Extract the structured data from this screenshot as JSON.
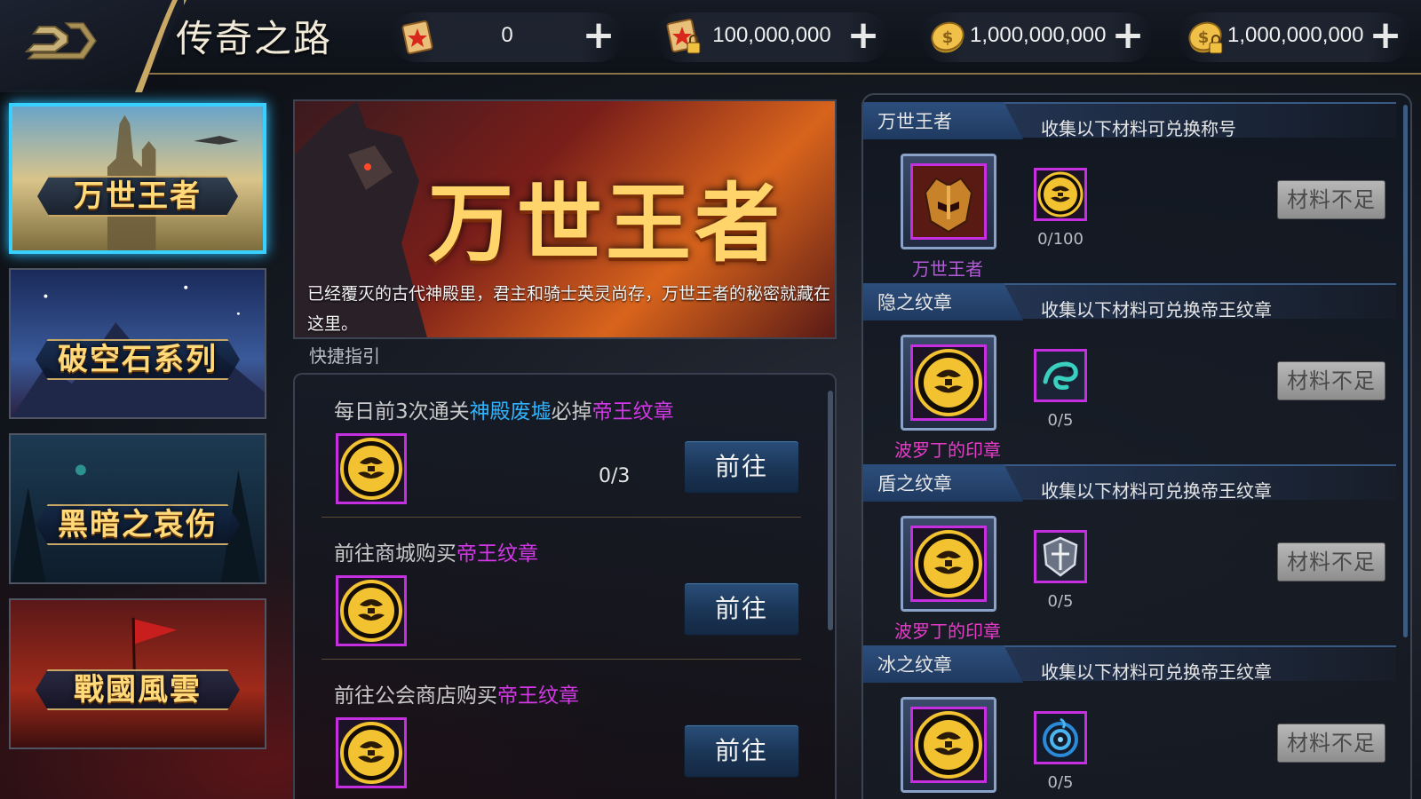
{
  "header": {
    "title": "传奇之路",
    "back_icon": "back-arrow-icon",
    "currencies": [
      {
        "icon": "red-scroll-icon",
        "value": "0"
      },
      {
        "icon": "locked-red-scroll-icon",
        "value": "100,000,000"
      },
      {
        "icon": "gold-coin-icon",
        "value": "1,000,000,000"
      },
      {
        "icon": "locked-gold-coin-icon",
        "value": "1,000,000,000"
      }
    ],
    "plus_label": "+"
  },
  "nav": {
    "items": [
      {
        "label": "万世王者",
        "active": true
      },
      {
        "label": "破空石系列",
        "active": false
      },
      {
        "label": "黑暗之哀伤",
        "active": false
      },
      {
        "label": "戰國風雲",
        "active": false
      }
    ]
  },
  "banner": {
    "title": "万世王者",
    "description": "已经覆灭的古代神殿里，君主和骑士英灵尚存，万世王者的秘密就藏在这里。"
  },
  "guide": {
    "label": "快捷指引",
    "tasks": [
      {
        "prefix": "每日前3次通关",
        "place": "神殿废墟",
        "middle": "必掉",
        "item": "帝王纹章",
        "progress": "0/3",
        "button": "前往"
      },
      {
        "prefix": "前往商城购买",
        "place": "",
        "middle": "",
        "item": "帝王纹章",
        "progress": "",
        "button": "前往"
      },
      {
        "prefix": "前往公会商店购买",
        "place": "",
        "middle": "",
        "item": "帝王纹章",
        "progress": "",
        "button": "前往"
      }
    ]
  },
  "exchange": {
    "items": [
      {
        "title": "万世王者",
        "desc": "收集以下材料可兑换称号",
        "reward_name": "万世王者",
        "reward_color": "#b35bd8",
        "reward_icon": "warrior-helmet-icon",
        "material_icon": "emperor-crest-icon",
        "count": "0/100",
        "button": "材料不足"
      },
      {
        "title": "隐之纹章",
        "desc": "收集以下材料可兑换帝王纹章",
        "reward_name": "波罗丁的印章",
        "reward_color": "#e63cc8",
        "reward_icon": "emperor-crest-icon",
        "material_icon": "serpent-emblem-icon",
        "count": "0/5",
        "button": "材料不足"
      },
      {
        "title": "盾之纹章",
        "desc": "收集以下材料可兑换帝王纹章",
        "reward_name": "波罗丁的印章",
        "reward_color": "#e63cc8",
        "reward_icon": "emperor-crest-icon",
        "material_icon": "shield-emblem-icon",
        "count": "0/5",
        "button": "材料不足"
      },
      {
        "title": "冰之纹章",
        "desc": "收集以下材料可兑换帝王纹章",
        "reward_name": "",
        "reward_color": "#e63cc8",
        "reward_icon": "emperor-crest-icon",
        "material_icon": "ice-vortex-icon",
        "count": "0/5",
        "button": "材料不足"
      }
    ]
  },
  "colors": {
    "accent_gold": "#c9a865",
    "active_border": "#38d0ff",
    "highlight_blue": "#2fb4ff",
    "highlight_purple": "#d338e6",
    "item_frame": "#c62fe0"
  }
}
